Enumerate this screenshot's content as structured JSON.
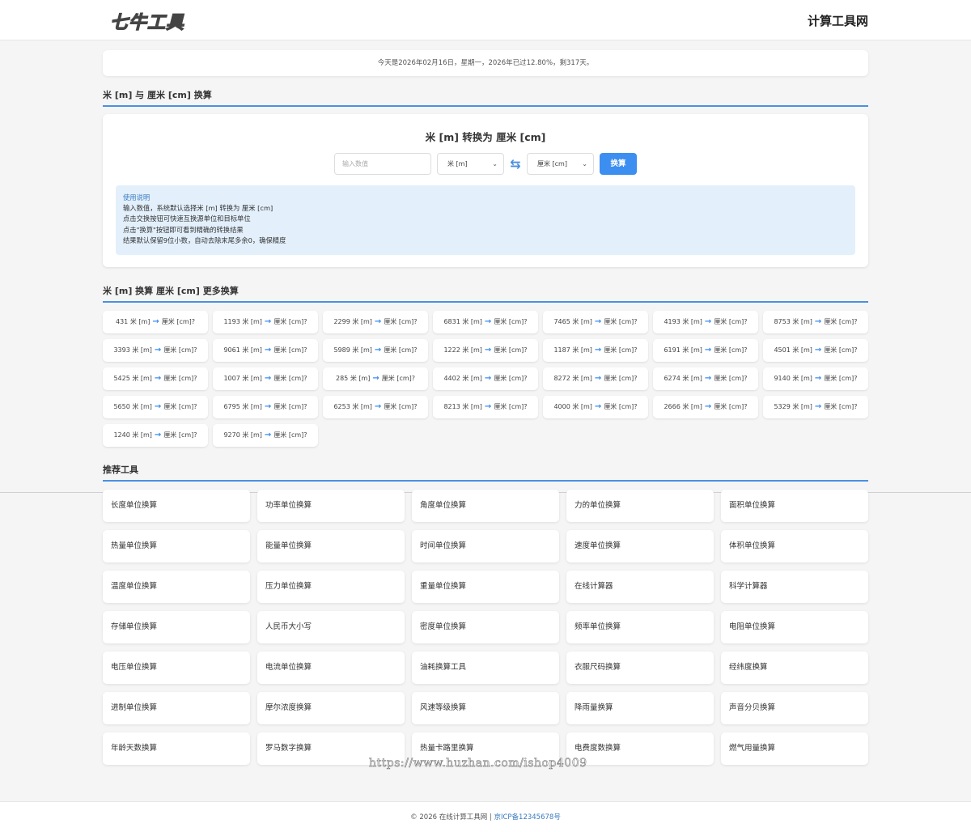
{
  "header": {
    "logo_text": "七牛工具",
    "site_title": "计算工具网"
  },
  "date_bar": "今天是2026年02月16日，星期一，2026年已过12.80%，剩317天。",
  "converter": {
    "section_title": "米 [m] 与 厘米 [cm] 换算",
    "panel_title": "米 [m] 转换为 厘米 [cm]",
    "input_placeholder": "输入数值",
    "from_unit": "米 [m]",
    "to_unit": "厘米 [cm]",
    "swap_icon": "swap-arrows-icon",
    "convert_label": "换算",
    "help": {
      "title": "使用说明",
      "lines": [
        "输入数值，系统默认选择米 [m] 转换为 厘米 [cm]",
        "点击交换按钮可快速互换源单位和目标单位",
        "点击\"换算\"按钮即可看到精确的转换结果",
        "结果默认保留9位小数，自动去除末尾多余0，确保精度"
      ]
    }
  },
  "more": {
    "section_title": "米 [m] 换算 厘米 [cm] 更多换算",
    "from_label": "米 [m]",
    "to_label": "厘米 [cm]?",
    "values": [
      "431",
      "1193",
      "2299",
      "6831",
      "7465",
      "4193",
      "8753",
      "3393",
      "9061",
      "5989",
      "1222",
      "1187",
      "6191",
      "4501",
      "5425",
      "1007",
      "285",
      "4402",
      "8272",
      "6274",
      "9140",
      "5650",
      "6795",
      "6253",
      "8213",
      "4000",
      "2666",
      "5329",
      "1240",
      "9270"
    ]
  },
  "tools": {
    "section_title": "推荐工具",
    "items": [
      "长度单位换算",
      "功率单位换算",
      "角度单位换算",
      "力的单位换算",
      "面积单位换算",
      "热量单位换算",
      "能量单位换算",
      "时间单位换算",
      "速度单位换算",
      "体积单位换算",
      "温度单位换算",
      "压力单位换算",
      "重量单位换算",
      "在线计算器",
      "科学计算器",
      "存储单位换算",
      "人民币大小写",
      "密度单位换算",
      "频率单位换算",
      "电阻单位换算",
      "电压单位换算",
      "电流单位换算",
      "油耗换算工具",
      "衣服尺码换算",
      "经纬度换算",
      "进制单位换算",
      "摩尔浓度换算",
      "风速等级换算",
      "降雨量换算",
      "声音分贝换算",
      "年龄天数换算",
      "罗马数字换算",
      "热量卡路里换算",
      "电费度数换算",
      "燃气用量换算"
    ]
  },
  "watermark": "https://www.huzhan.com/ishop4009",
  "footer": {
    "copyright": "© 2026 在线计算工具网 | ",
    "icp": "京ICP备12345678号"
  }
}
